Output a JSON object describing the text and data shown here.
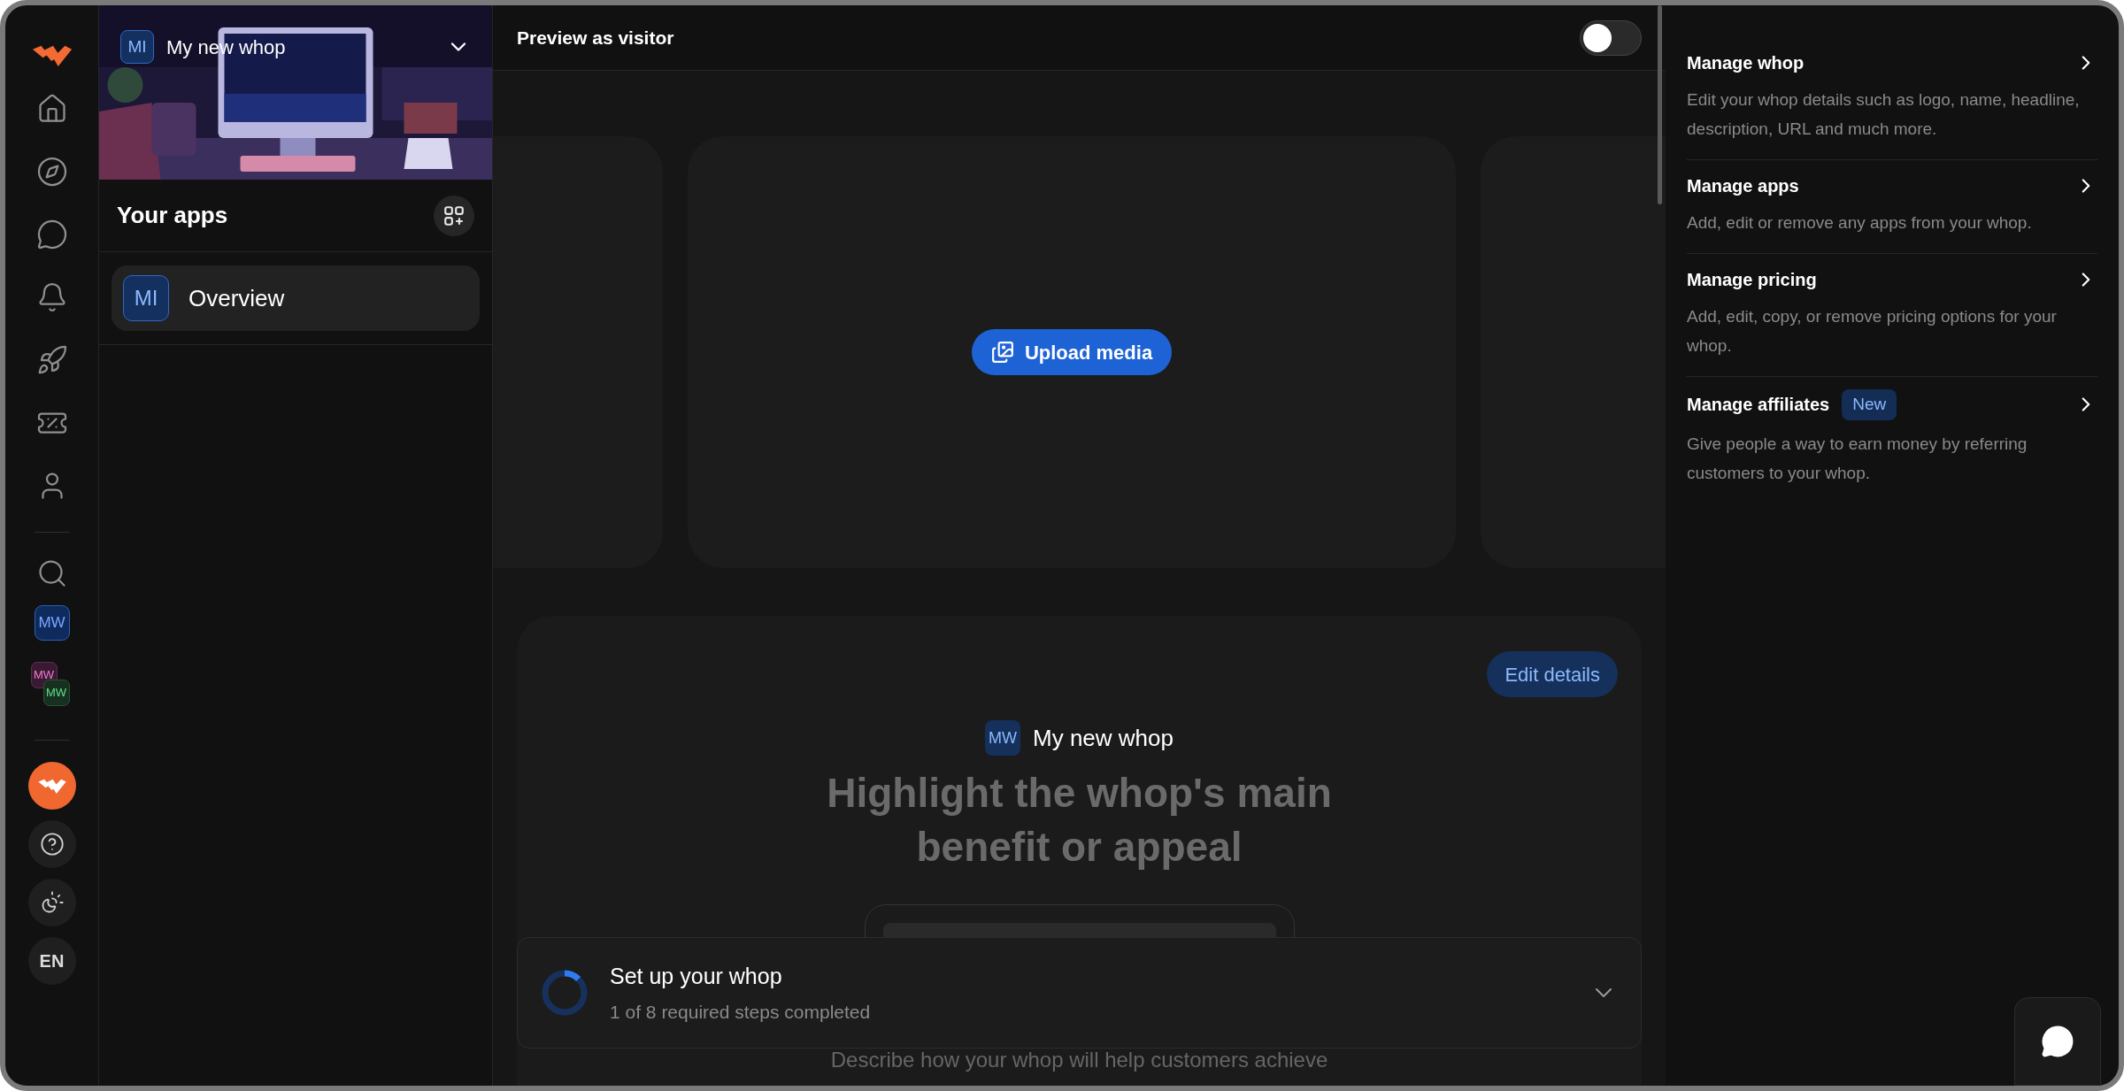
{
  "rail": {
    "items": [
      {
        "kind": "icon"
      },
      {
        "kind": "icon"
      },
      {
        "kind": "icon"
      },
      {
        "kind": "icon"
      },
      {
        "kind": "icon"
      },
      {
        "kind": "icon"
      },
      {
        "kind": "icon"
      },
      {
        "kind": "divider"
      },
      {
        "kind": "icon"
      },
      {
        "kind": "avatar",
        "label": "MW"
      },
      {
        "kind": "stack",
        "labels": [
          "MW",
          "MW"
        ]
      },
      {
        "kind": "divider"
      },
      {
        "kind": "brand"
      },
      {
        "kind": "round"
      },
      {
        "kind": "round"
      },
      {
        "kind": "round",
        "label": "EN"
      }
    ]
  },
  "apps_panel": {
    "whop_avatar": "MI",
    "whop_name": "My new whop",
    "title": "Your apps",
    "items": [
      {
        "avatar": "MI",
        "label": "Overview",
        "selected": true
      }
    ]
  },
  "preview": {
    "title": "Preview as visitor",
    "toggle_on": false,
    "upload_button": "Upload media",
    "hero": {
      "edit_button": "Edit details",
      "avatar": "MW",
      "name": "My new whop",
      "headline": "Highlight the whop's main benefit or appeal",
      "description": "Describe how your whop will help customers achieve"
    },
    "setup": {
      "title": "Set up your whop",
      "subtitle": "1 of 8 required steps completed",
      "level": 0.125
    }
  },
  "manage": [
    {
      "title": "Manage whop",
      "description": "Edit your whop details such as logo, name, headline, description, URL and much more."
    },
    {
      "title": "Manage apps",
      "description": "Add, edit or remove any apps from your whop."
    },
    {
      "title": "Manage pricing",
      "description": "Add, edit, copy, or remove pricing options for your whop."
    },
    {
      "title": "Manage affiliates",
      "badge": "New",
      "description": "Give people a way to earn money by referring customers to your whop."
    }
  ]
}
